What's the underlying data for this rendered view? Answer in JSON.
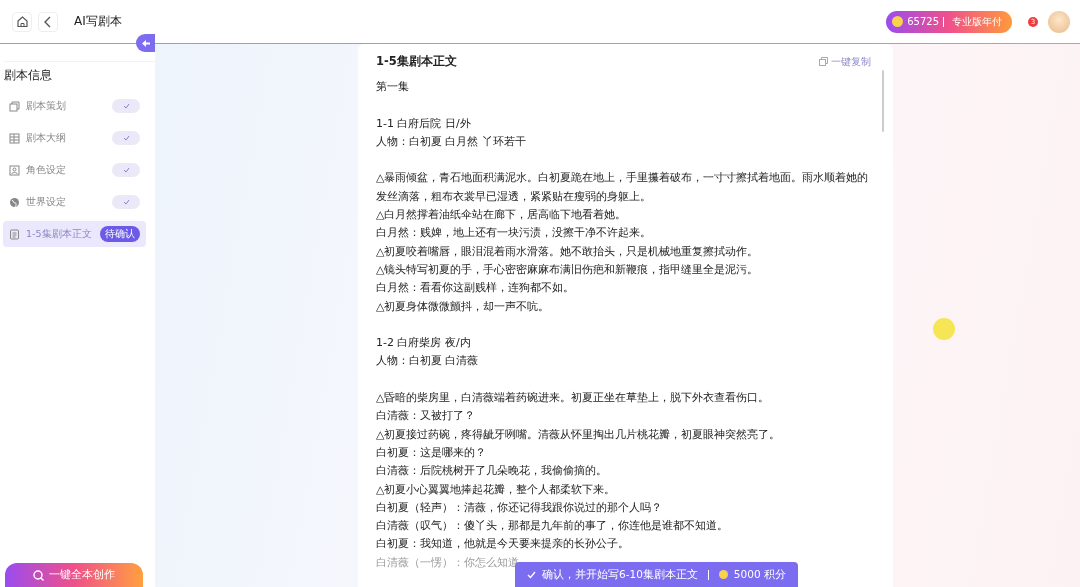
{
  "header": {
    "title": "AI写剧本",
    "points": "65725",
    "plan": "专业版年付",
    "notification_count": "3"
  },
  "sidebar": {
    "heading": "剧本信息",
    "items": [
      {
        "label": "剧本策划",
        "kind": "done",
        "selected": false
      },
      {
        "label": "剧本大纲",
        "kind": "done",
        "selected": false
      },
      {
        "label": "角色设定",
        "kind": "done",
        "selected": false
      },
      {
        "label": "世界设定",
        "kind": "done",
        "selected": false
      },
      {
        "label": "1-5集剧本正文",
        "kind": "pending",
        "badge": "待确认",
        "selected": true
      }
    ],
    "create_button": "一键全本创作"
  },
  "document": {
    "title": "1-5集剧本正文",
    "copy_label": "一键复制",
    "blocks": [
      {
        "lines": [
          {
            "text": "第一集",
            "faded": false
          }
        ]
      },
      {
        "lines": [
          {
            "text": "1-1 白府后院 日/外",
            "faded": false
          },
          {
            "text": "人物：白初夏 白月然 丫环若干",
            "faded": false
          }
        ]
      },
      {
        "lines": [
          {
            "text": "△暴雨倾盆，青石地面积满泥水。白初夏跪在地上，手里攥着破布，一寸寸擦拭着地面。雨水顺着她的发丝滴落，粗布衣裳早已湿透，紧紧贴在瘦弱的身躯上。",
            "faded": false
          },
          {
            "text": "△白月然撑着油纸伞站在廊下，居高临下地看着她。",
            "faded": false
          },
          {
            "text": "白月然：贱婢，地上还有一块污渍，没擦干净不许起来。",
            "faded": false
          },
          {
            "text": "△初夏咬着嘴唇，眼泪混着雨水滑落。她不敢抬头，只是机械地重复擦拭动作。",
            "faded": false
          },
          {
            "text": "△镜头特写初夏的手，手心密密麻麻布满旧伤疤和新鞭痕，指甲缝里全是泥污。",
            "faded": false
          },
          {
            "text": "白月然：看看你这副贱样，连狗都不如。",
            "faded": false
          },
          {
            "text": "△初夏身体微微颤抖，却一声不吭。",
            "faded": false
          }
        ]
      },
      {
        "lines": [
          {
            "text": "1-2 白府柴房 夜/内",
            "faded": false
          },
          {
            "text": "人物：白初夏 白清薇",
            "faded": false
          }
        ]
      },
      {
        "lines": [
          {
            "text": "△昏暗的柴房里，白清薇端着药碗进来。初夏正坐在草垫上，脱下外衣查看伤口。",
            "faded": false
          },
          {
            "text": "白清薇：又被打了？",
            "faded": false
          },
          {
            "text": "△初夏接过药碗，疼得龇牙咧嘴。清薇从怀里掏出几片桃花瓣，初夏眼神突然亮了。",
            "faded": false
          },
          {
            "text": "白初夏：这是哪来的？",
            "faded": false
          },
          {
            "text": "白清薇：后院桃树开了几朵晚花，我偷偷摘的。",
            "faded": false
          },
          {
            "text": "△初夏小心翼翼地捧起花瓣，整个人都柔软下来。",
            "faded": false
          },
          {
            "text": "白初夏（轻声）：清薇，你还记得我跟你说过的那个人吗？",
            "faded": false
          },
          {
            "text": "白清薇（叹气）：傻丫头，那都是九年前的事了，你连他是谁都不知道。",
            "faded": false
          },
          {
            "text": "白初夏：我知道，他就是今天要来提亲的长孙公子。",
            "faded": false
          },
          {
            "text": "白清薇（一愣）：你怎么知道",
            "faded": true
          }
        ]
      }
    ]
  },
  "confirm_button": {
    "label": "确认，并开始写6-10集剧本正文",
    "cost": "5000 积分"
  }
}
